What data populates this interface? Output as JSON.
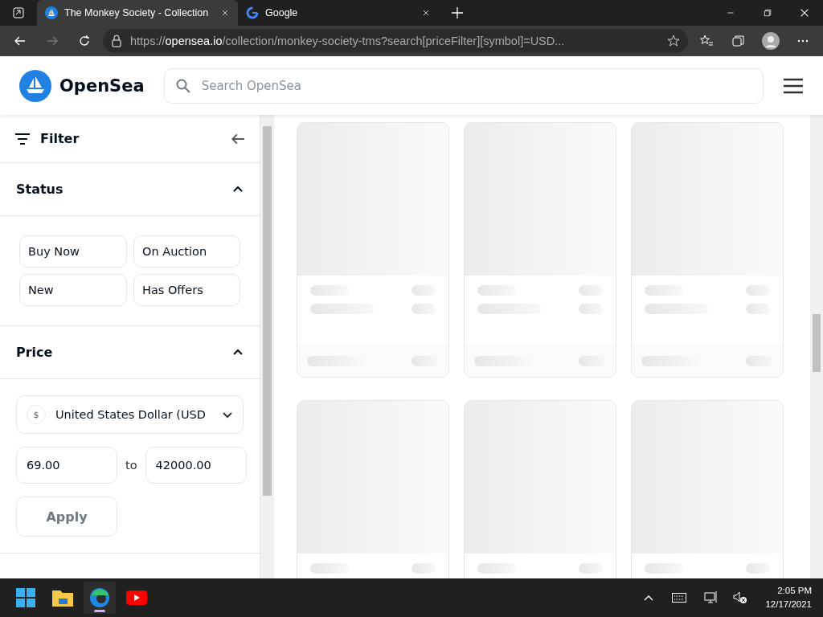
{
  "browser": {
    "tabs": [
      {
        "title": "The Monkey Society - Collection",
        "selected": true,
        "kind": "opensea"
      },
      {
        "title": "Google",
        "selected": false,
        "kind": "google"
      }
    ],
    "url": {
      "scheme": "https://",
      "host": "opensea.io",
      "path": "/collection/monkey-society-tms?search[priceFilter][symbol]=USD..."
    }
  },
  "header": {
    "logo": "OpenSea",
    "search": {
      "placeholder": "Search OpenSea"
    }
  },
  "filter": {
    "title": "Filter",
    "sections": [
      {
        "title": "Status",
        "expanded": true,
        "kind": "status",
        "options": [
          "Buy Now",
          "On Auction",
          "New",
          "Has Offers"
        ]
      },
      {
        "title": "Price",
        "expanded": true,
        "kind": "price",
        "currency": "United States Dollar (USD",
        "currency_symbol": "$",
        "min": "69.00",
        "separator": "to",
        "max": "42000.00",
        "apply": "Apply"
      }
    ]
  },
  "cards": [
    {
      "kind": "skeleton"
    },
    {
      "kind": "skeleton"
    },
    {
      "kind": "skeleton"
    },
    {
      "kind": "skeleton"
    },
    {
      "kind": "skeleton"
    },
    {
      "kind": "skeleton"
    }
  ],
  "taskbar": {
    "apps": [
      {
        "kind": "start",
        "active": false
      },
      {
        "kind": "files",
        "active": false
      },
      {
        "kind": "browser",
        "active": true
      },
      {
        "kind": "video",
        "active": false
      }
    ],
    "time": "2:05 PM",
    "date": "12/17/2021"
  }
}
